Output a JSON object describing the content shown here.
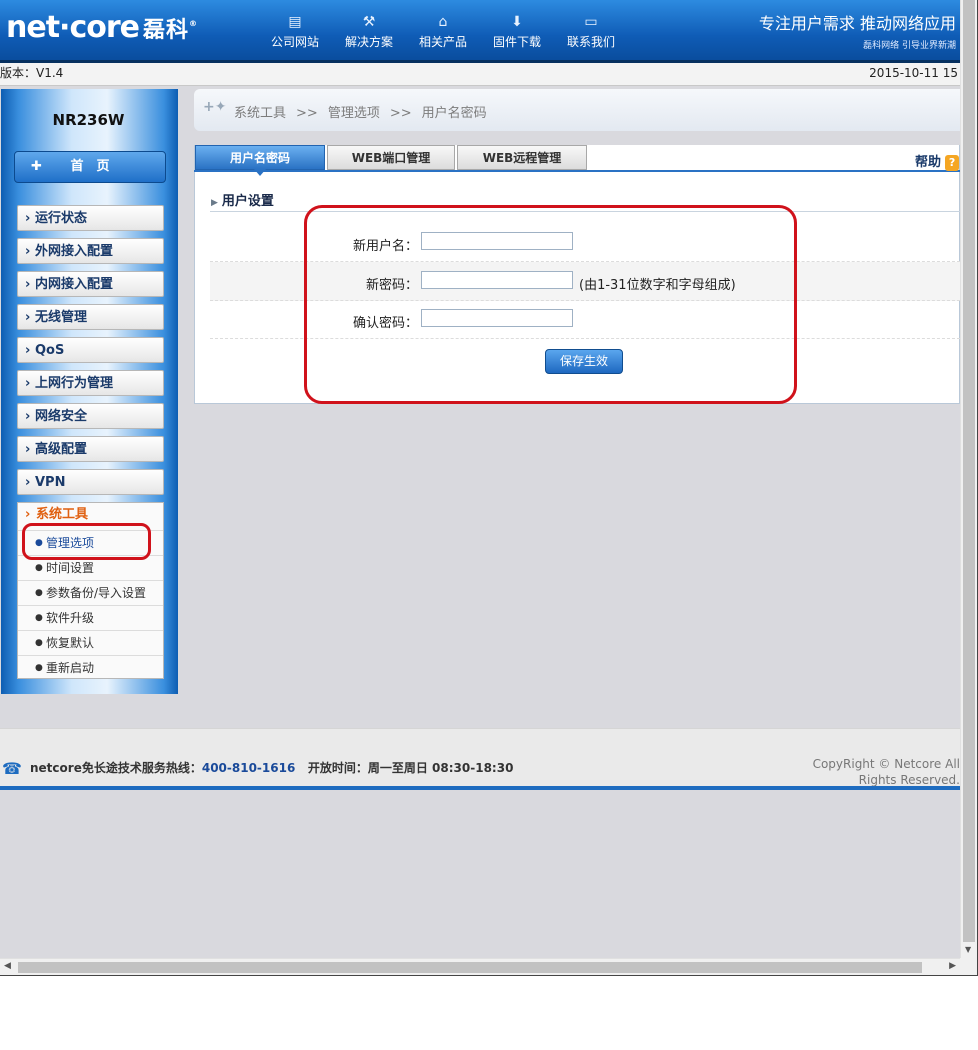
{
  "header": {
    "logo": "net·core",
    "logo_cn": "磊科",
    "logo_reg": "®",
    "nav": [
      {
        "label": "公司网站",
        "icon": "website-icon",
        "glyph": "▤"
      },
      {
        "label": "解决方案",
        "icon": "tools-icon",
        "glyph": "⚒"
      },
      {
        "label": "相关产品",
        "icon": "router-icon",
        "glyph": "⌂"
      },
      {
        "label": "固件下载",
        "icon": "download-icon",
        "glyph": "⬇"
      },
      {
        "label": "联系我们",
        "icon": "chat-icon",
        "glyph": "▭"
      }
    ],
    "slogan": "专注用户需求  推动网络应用",
    "slogan_sub": "磊科网络 引导业界新潮"
  },
  "infobar": {
    "version": "版本：V1.4",
    "date": "2015-10-11 15"
  },
  "sidebar": {
    "model": "NR236W",
    "home": "首　页",
    "items": [
      "运行状态",
      "外网接入配置",
      "内网接入配置",
      "无线管理",
      "QoS",
      "上网行为管理",
      "网络安全",
      "高级配置",
      "VPN"
    ],
    "open_menu": "系统工具",
    "subitems": [
      "管理选项",
      "时间设置",
      "参数备份/导入设置",
      "软件升级",
      "恢复默认",
      "重新启动"
    ]
  },
  "breadcrumb": [
    "系统工具",
    ">>",
    "管理选项",
    ">>",
    "用户名密码"
  ],
  "tabs": [
    {
      "label": "用户名密码",
      "active": true
    },
    {
      "label": "WEB端口管理",
      "active": false
    },
    {
      "label": "WEB远程管理",
      "active": false
    }
  ],
  "help": "帮助",
  "section_title": "用户设置",
  "form": {
    "new_username_label": "新用户名：",
    "new_username_value": "",
    "new_password_label": "新密码：",
    "new_password_value": "",
    "password_hint": "(由1-31位数字和字母组成)",
    "confirm_password_label": "确认密码：",
    "confirm_password_value": "",
    "save_label": "保存生效"
  },
  "footer": {
    "hotline_text": "netcore免长途技术服务热线：",
    "hotline_number": "400-810-1616",
    "hours": "开放时间：周一至周日 08:30-18:30",
    "copyright": "CopyRight © Netcore All Rights Reserved."
  },
  "colors": {
    "brand_blue": "#1e6cc0",
    "highlight_red": "#d0121b",
    "active_menu": "#e06010"
  }
}
